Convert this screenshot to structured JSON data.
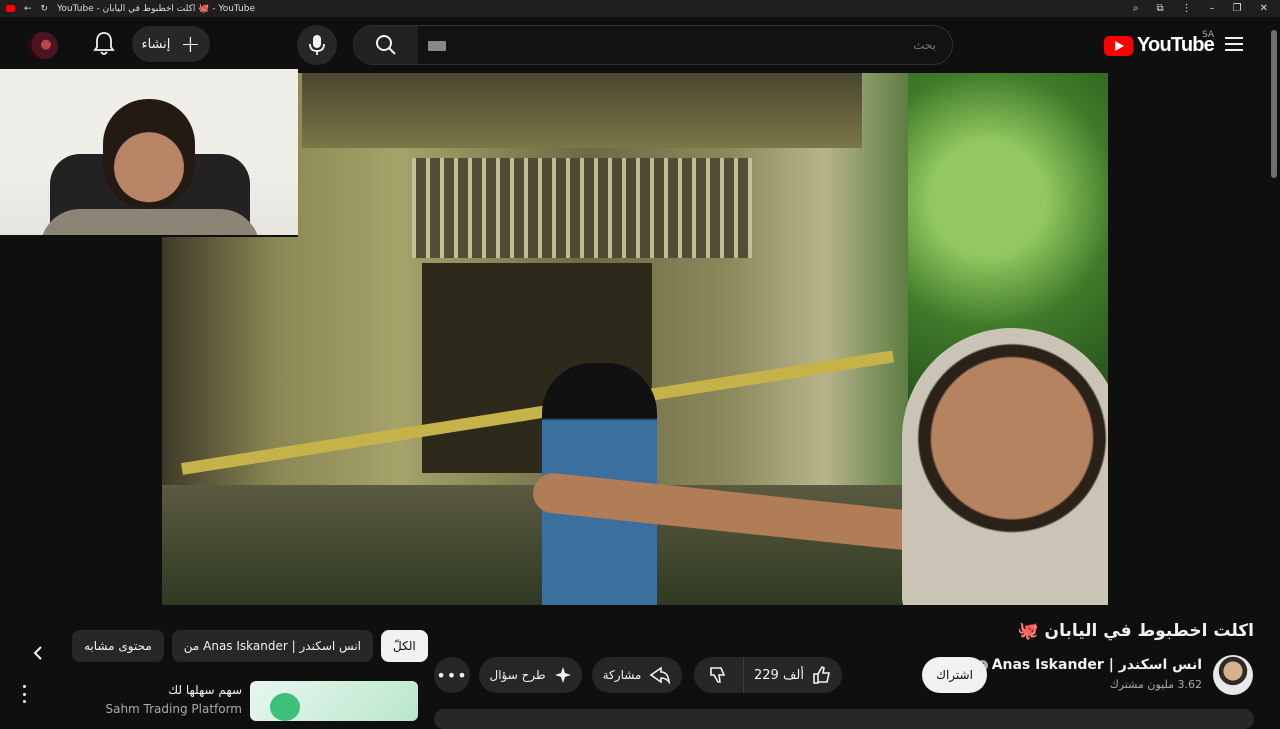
{
  "browser": {
    "tab_title": "YouTube - اكلت اخطبوط في اليابان 🐙 - YouTube",
    "back_icon": "arrow-left-icon",
    "reload_icon": "reload-icon"
  },
  "topbar": {
    "create_label": "إنشاء",
    "search_placeholder": "بحث",
    "logo_text": "YouTube",
    "country_code": "SA"
  },
  "video": {
    "title": "اكلت اخطبوط في اليابان 🐙",
    "channel_name": "انس اسكندر | Anas Iskander",
    "subscribers": "3.62 مليون مشترك",
    "subscribe_label": "اشتراك",
    "likes": "229 ألف",
    "share_label": "مشاركة",
    "ask_label": "طرح سؤال",
    "more_label": "•••"
  },
  "chips": [
    {
      "label": "الكلّ",
      "active": true
    },
    {
      "label": "من Anas Iskander | انس اسكندر",
      "active": false
    },
    {
      "label": "محتوى مشابه",
      "active": false
    }
  ],
  "recommendation": {
    "title": "سهم سهلها لك",
    "channel": "Sahm Trading Platform"
  },
  "colors": {
    "brand_red": "#ff0000",
    "background": "#0f0f0f",
    "button_bg": "#272727"
  }
}
